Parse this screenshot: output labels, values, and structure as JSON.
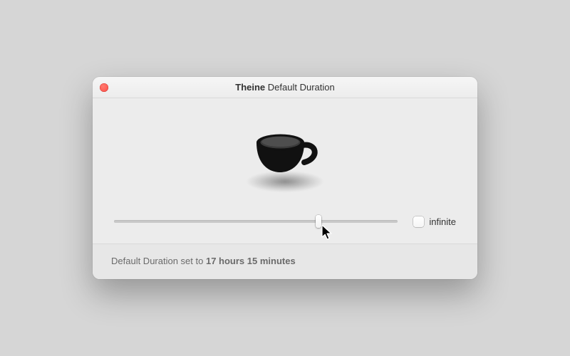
{
  "window": {
    "title_app": "Theine",
    "title_rest": "Default Duration"
  },
  "slider": {
    "position_percent": 72
  },
  "checkbox": {
    "label": "infinite",
    "checked": false
  },
  "footer": {
    "prefix": "Default Duration set to ",
    "value": "17 hours 15 minutes"
  },
  "colors": {
    "close_button": "#ff5f57",
    "window_bg": "#ececec"
  }
}
